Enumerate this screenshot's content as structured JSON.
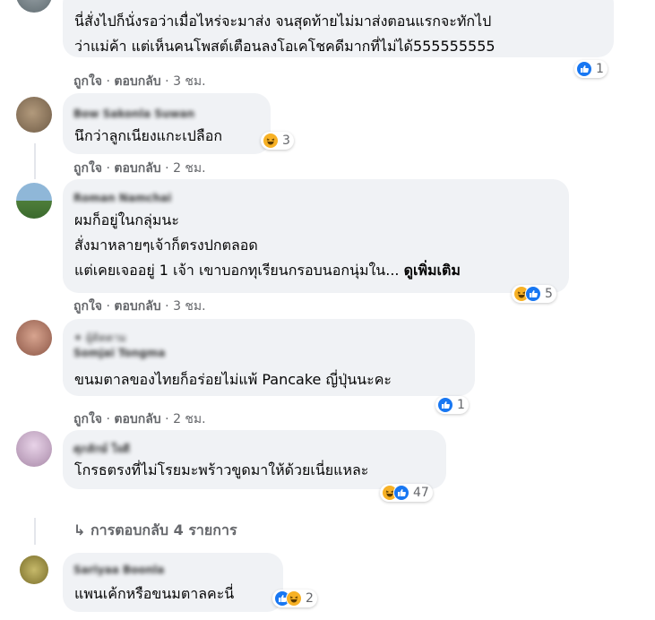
{
  "colors": {
    "bubble": "#f0f2f5",
    "meta": "#65676b",
    "like": "#1877f2",
    "haha": "#f7b125"
  },
  "actions": {
    "like": "ถูกใจ",
    "reply": "ตอบกลับ",
    "sep": "·"
  },
  "comments": [
    {
      "lines": [
        "นี่สั่งไปก็นั่งรอว่าเมื่อไหร่จะมาส่ง จนสุดท้ายไม่มาส่งตอนแรกจะทักไป",
        "ว่าแม่ค้า แต่เห็นคนโพสต์เตือนลงโอเคโชคดีมากที่ไม่ได้555555555"
      ],
      "time": "3 ชม.",
      "reactions": [
        "like-icon"
      ],
      "count": "1"
    },
    {
      "name": "Bow Sakonla Suwan",
      "lines": [
        "นึกว่าลูกเนียงแกะเปลือก"
      ],
      "time": "2 ชม.",
      "reactions": [
        "haha-icon"
      ],
      "count": "3"
    },
    {
      "name": "Roman Namchai",
      "lines": [
        "ผมก็อยู่ในกลุ่มนะ",
        "สั่งมาหลายๆเจ้าก็ตรงปกตลอด",
        "แต่เคยเจออยู่ 1 เจ้า เขาบอกทุเรียนกรอบนอกนุ่มใน..."
      ],
      "see_more": "ดูเพิ่มเติม",
      "time": "3 ชม.",
      "reactions": [
        "haha-icon",
        "like-icon"
      ],
      "count": "5"
    },
    {
      "tag": "✦ ผู้ติดตาม",
      "name": "Somjai Tongma",
      "lines": [
        "ขนมตาลของไทยก็อร่อยไม่แพ้ Pancake ญี่ปุ่นนะคะ"
      ],
      "time": "2 ชม.",
      "reactions": [
        "like-icon"
      ],
      "count": "1"
    },
    {
      "name": "ศุภลักษ์ ใจดี",
      "lines": [
        "โกรธตรงที่ไม่โรยมะพร้าวขูดมาให้ด้วยเนี่ยแหละ"
      ],
      "reactions": [
        "haha-icon",
        "like-icon"
      ],
      "count": "47"
    },
    {
      "name": "Sariyaa Boonla",
      "lines": [
        "แพนเค้กหรือขนมตาลคะนี่"
      ],
      "reactions": [
        "like-icon",
        "haha-icon"
      ],
      "count": "2"
    }
  ],
  "view_replies": "↳ การตอบกลับ 4 รายการ"
}
